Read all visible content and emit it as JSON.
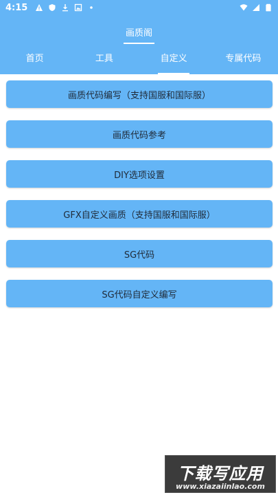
{
  "status_bar": {
    "time": "4:15",
    "accent": "#64B5F6"
  },
  "app": {
    "title": "画质阁"
  },
  "tabs": [
    {
      "label": "首页"
    },
    {
      "label": "工具"
    },
    {
      "label": "自定义",
      "active": true
    },
    {
      "label": "专属代码"
    }
  ],
  "buttons": [
    {
      "label": "画质代码编写（支持国服和国际服）"
    },
    {
      "label": "画质代码参考"
    },
    {
      "label": "DIY选项设置"
    },
    {
      "label": "GFX自定义画质（支持国服和国际服）"
    },
    {
      "label": "SG代码"
    },
    {
      "label": "SG代码自定义编写"
    }
  ],
  "watermark": {
    "title": "下载写应用",
    "url": "www.xiazaiinlao.com"
  }
}
